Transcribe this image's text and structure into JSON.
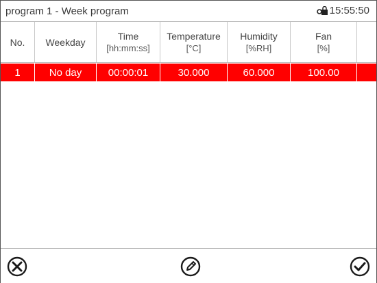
{
  "titlebar": {
    "title": "program 1 - Week program",
    "time": "15:55:50",
    "lock_icon": "lock-icon"
  },
  "table": {
    "columns": [
      {
        "label": "No.",
        "unit": ""
      },
      {
        "label": "Weekday",
        "unit": ""
      },
      {
        "label": "Time",
        "unit": "[hh:mm:ss]"
      },
      {
        "label": "Temperature",
        "unit": "[°C]"
      },
      {
        "label": "Humidity",
        "unit": "[%RH]"
      },
      {
        "label": "Fan",
        "unit": "[%]"
      }
    ],
    "rows": [
      {
        "no": "1",
        "weekday": "No day",
        "time": "00:00:01",
        "temperature": "30.000",
        "humidity": "60.000",
        "fan": "100.00"
      }
    ],
    "selected_row_color": "#ff0000"
  },
  "footer": {
    "cancel_icon": "cancel-icon",
    "edit_icon": "edit-pencil-icon",
    "confirm_icon": "confirm-check-icon"
  }
}
